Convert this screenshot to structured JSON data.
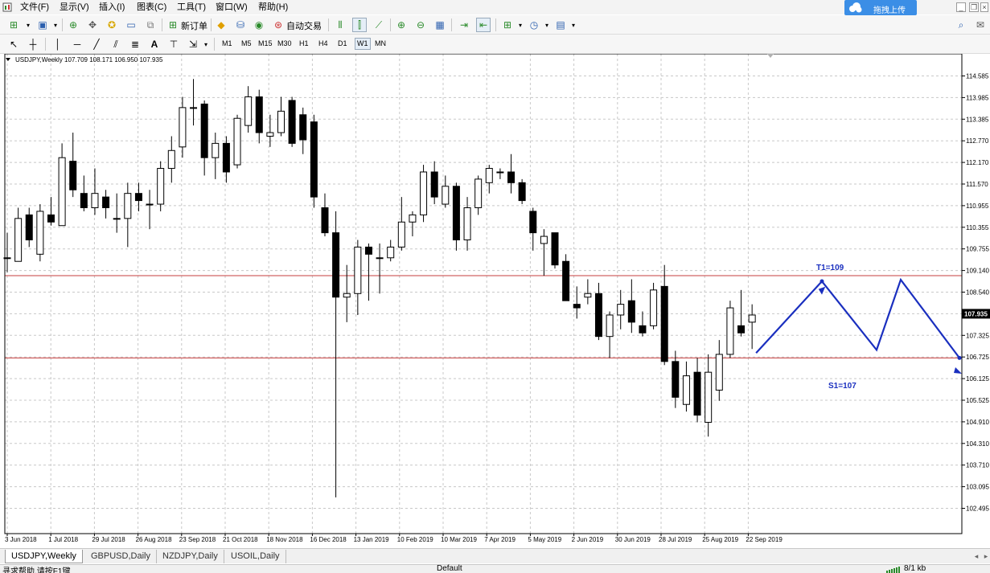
{
  "menu": {
    "items": [
      "文件(F)",
      "显示(V)",
      "插入(I)",
      "图表(C)",
      "工具(T)",
      "窗口(W)",
      "帮助(H)"
    ],
    "upload_label": "拖拽上传"
  },
  "toolbar": {
    "new_order_label": "新订单",
    "auto_trade_label": "自动交易",
    "timeframes": [
      "M1",
      "M5",
      "M15",
      "M30",
      "H1",
      "H4",
      "D1",
      "W1",
      "MN"
    ],
    "active_timeframe": "W1",
    "icons": [
      "new-chart-icon",
      "profiles-icon",
      "market-watch-icon",
      "data-window-icon",
      "navigator-icon",
      "terminal-icon",
      "strategy-tester-icon",
      "new-order-icon",
      "metaeditor-icon",
      "signals-icon",
      "autotrading-icon",
      "bar-chart-icon",
      "candlestick-icon",
      "line-chart-icon",
      "zoom-in-icon",
      "zoom-out-icon",
      "tile-icon",
      "autoscroll-icon",
      "chart-shift-icon",
      "indicators-icon",
      "periods-icon",
      "templates-icon",
      "cursor-icon",
      "crosshair-icon",
      "vertical-line-icon",
      "horizontal-line-icon",
      "trendline-icon",
      "equidistant-channel-icon",
      "fibonacci-icon",
      "text-icon",
      "text-label-icon",
      "arrows-icon",
      "search-icon",
      "chat-icon"
    ]
  },
  "chart_title": "USDJPY,Weekly  107.709 108.171 106.950 107.935",
  "chart_data": {
    "type": "candlestick",
    "symbol": "USDJPY",
    "timeframe": "Weekly",
    "ohlc_header": {
      "open": 107.709,
      "high": 108.171,
      "low": 106.95,
      "close": 107.935
    },
    "current_price": "107.935",
    "ylim": [
      102.495,
      115.0
    ],
    "y_ticks": [
      "114.585",
      "113.985",
      "113.385",
      "112.770",
      "112.170",
      "111.570",
      "110.955",
      "110.355",
      "109.755",
      "109.140",
      "108.540",
      "107.935",
      "107.325",
      "106.725",
      "106.125",
      "105.525",
      "104.910",
      "104.310",
      "103.710",
      "103.095",
      "102.495"
    ],
    "x_tick_labels": [
      "3 Jun 2018",
      "1 Jul 2018",
      "29 Jul 2018",
      "26 Aug 2018",
      "23 Sep 2018",
      "21 Oct 2018",
      "18 Nov 2018",
      "16 Dec 2018",
      "13 Jan 2019",
      "10 Feb 2019",
      "10 Mar 2019",
      "7 Apr 2019",
      "5 May 2019",
      "2 Jun 2019",
      "30 Jun 2019",
      "28 Jul 2019",
      "25 Aug 2019",
      "22 Sep 2019"
    ],
    "candles": [
      {
        "o": 109.5,
        "h": 110.2,
        "l": 109.1,
        "c": 109.5
      },
      {
        "o": 109.4,
        "h": 110.9,
        "l": 109.4,
        "c": 110.6
      },
      {
        "o": 110.7,
        "h": 110.9,
        "l": 109.8,
        "c": 110.0
      },
      {
        "o": 109.6,
        "h": 111.0,
        "l": 109.4,
        "c": 110.8
      },
      {
        "o": 110.7,
        "h": 111.2,
        "l": 110.4,
        "c": 110.5
      },
      {
        "o": 110.4,
        "h": 112.7,
        "l": 110.4,
        "c": 112.3
      },
      {
        "o": 112.2,
        "h": 113.0,
        "l": 111.2,
        "c": 111.4
      },
      {
        "o": 111.3,
        "h": 111.8,
        "l": 110.8,
        "c": 110.9
      },
      {
        "o": 110.9,
        "h": 112.0,
        "l": 110.7,
        "c": 111.3
      },
      {
        "o": 111.2,
        "h": 111.4,
        "l": 110.6,
        "c": 110.9
      },
      {
        "o": 110.6,
        "h": 111.3,
        "l": 110.2,
        "c": 110.6
      },
      {
        "o": 110.6,
        "h": 111.6,
        "l": 109.8,
        "c": 111.3
      },
      {
        "o": 111.3,
        "h": 111.6,
        "l": 110.8,
        "c": 111.1
      },
      {
        "o": 111.0,
        "h": 111.4,
        "l": 110.3,
        "c": 111.0
      },
      {
        "o": 111.0,
        "h": 112.2,
        "l": 110.8,
        "c": 112.0
      },
      {
        "o": 112.0,
        "h": 112.9,
        "l": 111.6,
        "c": 112.5
      },
      {
        "o": 112.6,
        "h": 114.0,
        "l": 112.3,
        "c": 113.7
      },
      {
        "o": 113.7,
        "h": 114.5,
        "l": 113.2,
        "c": 113.7
      },
      {
        "o": 113.8,
        "h": 113.9,
        "l": 111.8,
        "c": 112.3
      },
      {
        "o": 112.3,
        "h": 113.0,
        "l": 111.7,
        "c": 112.7
      },
      {
        "o": 112.7,
        "h": 112.9,
        "l": 111.6,
        "c": 111.9
      },
      {
        "o": 112.1,
        "h": 113.5,
        "l": 112.0,
        "c": 113.4
      },
      {
        "o": 113.2,
        "h": 114.3,
        "l": 113.0,
        "c": 114.0
      },
      {
        "o": 114.0,
        "h": 114.2,
        "l": 112.7,
        "c": 113.0
      },
      {
        "o": 112.9,
        "h": 113.5,
        "l": 112.6,
        "c": 113.0
      },
      {
        "o": 113.0,
        "h": 114.0,
        "l": 112.9,
        "c": 113.6
      },
      {
        "o": 113.9,
        "h": 114.0,
        "l": 112.6,
        "c": 112.7
      },
      {
        "o": 113.5,
        "h": 113.7,
        "l": 112.4,
        "c": 112.8
      },
      {
        "o": 113.3,
        "h": 113.5,
        "l": 110.9,
        "c": 111.2
      },
      {
        "o": 110.9,
        "h": 111.3,
        "l": 110.1,
        "c": 110.2
      },
      {
        "o": 110.2,
        "h": 110.8,
        "l": 102.8,
        "c": 108.4
      },
      {
        "o": 108.4,
        "h": 109.3,
        "l": 107.7,
        "c": 108.5
      },
      {
        "o": 108.5,
        "h": 110.0,
        "l": 107.9,
        "c": 109.8
      },
      {
        "o": 109.8,
        "h": 109.9,
        "l": 108.3,
        "c": 109.6
      },
      {
        "o": 109.5,
        "h": 109.9,
        "l": 108.5,
        "c": 109.5
      },
      {
        "o": 109.5,
        "h": 110.0,
        "l": 109.4,
        "c": 109.8
      },
      {
        "o": 109.8,
        "h": 111.2,
        "l": 109.7,
        "c": 110.5
      },
      {
        "o": 110.5,
        "h": 110.8,
        "l": 110.1,
        "c": 110.7
      },
      {
        "o": 110.7,
        "h": 112.1,
        "l": 110.5,
        "c": 111.9
      },
      {
        "o": 111.9,
        "h": 112.2,
        "l": 111.0,
        "c": 111.2
      },
      {
        "o": 111.0,
        "h": 111.8,
        "l": 110.9,
        "c": 111.5
      },
      {
        "o": 111.5,
        "h": 111.6,
        "l": 109.7,
        "c": 110.0
      },
      {
        "o": 110.0,
        "h": 111.2,
        "l": 109.7,
        "c": 110.9
      },
      {
        "o": 110.9,
        "h": 111.8,
        "l": 110.7,
        "c": 111.7
      },
      {
        "o": 111.6,
        "h": 112.1,
        "l": 111.3,
        "c": 112.0
      },
      {
        "o": 111.9,
        "h": 112.0,
        "l": 111.7,
        "c": 111.9
      },
      {
        "o": 111.9,
        "h": 112.4,
        "l": 111.3,
        "c": 111.6
      },
      {
        "o": 111.6,
        "h": 111.7,
        "l": 111.0,
        "c": 111.1
      },
      {
        "o": 110.8,
        "h": 110.9,
        "l": 109.7,
        "c": 110.2
      },
      {
        "o": 109.9,
        "h": 110.3,
        "l": 109.0,
        "c": 110.1
      },
      {
        "o": 110.2,
        "h": 110.2,
        "l": 109.2,
        "c": 109.3
      },
      {
        "o": 109.4,
        "h": 109.6,
        "l": 108.3,
        "c": 108.3
      },
      {
        "o": 108.2,
        "h": 108.7,
        "l": 107.8,
        "c": 108.1
      },
      {
        "o": 108.4,
        "h": 108.9,
        "l": 108.2,
        "c": 108.5
      },
      {
        "o": 108.5,
        "h": 108.8,
        "l": 107.2,
        "c": 107.3
      },
      {
        "o": 107.3,
        "h": 108.0,
        "l": 106.7,
        "c": 107.9
      },
      {
        "o": 107.9,
        "h": 108.6,
        "l": 107.5,
        "c": 108.2
      },
      {
        "o": 108.3,
        "h": 108.9,
        "l": 107.4,
        "c": 107.7
      },
      {
        "o": 107.6,
        "h": 108.0,
        "l": 107.3,
        "c": 107.4
      },
      {
        "o": 107.6,
        "h": 108.8,
        "l": 107.5,
        "c": 108.6
      },
      {
        "o": 108.7,
        "h": 109.3,
        "l": 106.5,
        "c": 106.6
      },
      {
        "o": 106.6,
        "h": 106.9,
        "l": 105.3,
        "c": 105.6
      },
      {
        "o": 105.4,
        "h": 106.6,
        "l": 105.2,
        "c": 106.2
      },
      {
        "o": 106.3,
        "h": 106.7,
        "l": 104.9,
        "c": 105.1
      },
      {
        "o": 104.9,
        "h": 106.8,
        "l": 104.5,
        "c": 106.3
      },
      {
        "o": 105.8,
        "h": 107.2,
        "l": 105.5,
        "c": 106.8
      },
      {
        "o": 106.8,
        "h": 108.3,
        "l": 106.7,
        "c": 108.1
      },
      {
        "o": 107.6,
        "h": 108.6,
        "l": 107.3,
        "c": 107.4
      },
      {
        "o": 107.7,
        "h": 108.2,
        "l": 106.95,
        "c": 107.9
      }
    ],
    "hlines": [
      {
        "value": 109.0,
        "color": "#c43c3c"
      },
      {
        "value": 106.7,
        "color": "#c43c3c"
      }
    ],
    "annotations": [
      {
        "text": "T1=109",
        "color": "#1a2fbf"
      },
      {
        "text": "S1=107",
        "color": "#1a2fbf"
      }
    ],
    "projection_color": "#1a2fbf",
    "grid": true
  },
  "tabs": [
    "USDJPY,Weekly",
    "GBPUSD,Daily",
    "NZDJPY,Daily",
    "USOIL,Daily"
  ],
  "active_tab": "USDJPY,Weekly",
  "status": {
    "help": "寻求帮助,请按F1键",
    "profile": "Default",
    "traffic": "8/1 kb"
  }
}
